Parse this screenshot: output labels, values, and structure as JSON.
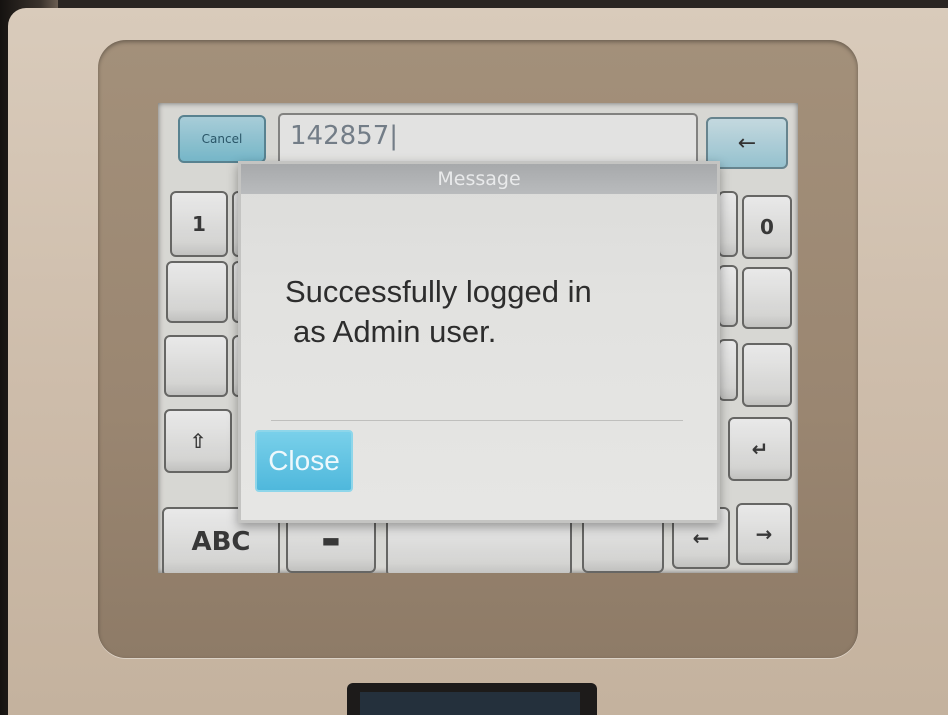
{
  "keypad": {
    "cancel_label": "Cancel",
    "entry_value": "142857|",
    "backspace_symbol": "←",
    "key_1": "1",
    "key_0": "0",
    "shift_symbol": "⇧",
    "enter_symbol": "↵",
    "abc_label": "ABC",
    "folder_symbol": "▬",
    "left_arrow": "←",
    "right_arrow": "→"
  },
  "dialog": {
    "title": "Message",
    "message_line1": "Successfully logged in",
    "message_line2": "as Admin user.",
    "close_label": "Close"
  },
  "colors": {
    "accent": "#4fb8dc",
    "dialog_title_bg": "#a7a9ab",
    "housing": "#cdbcaa"
  }
}
